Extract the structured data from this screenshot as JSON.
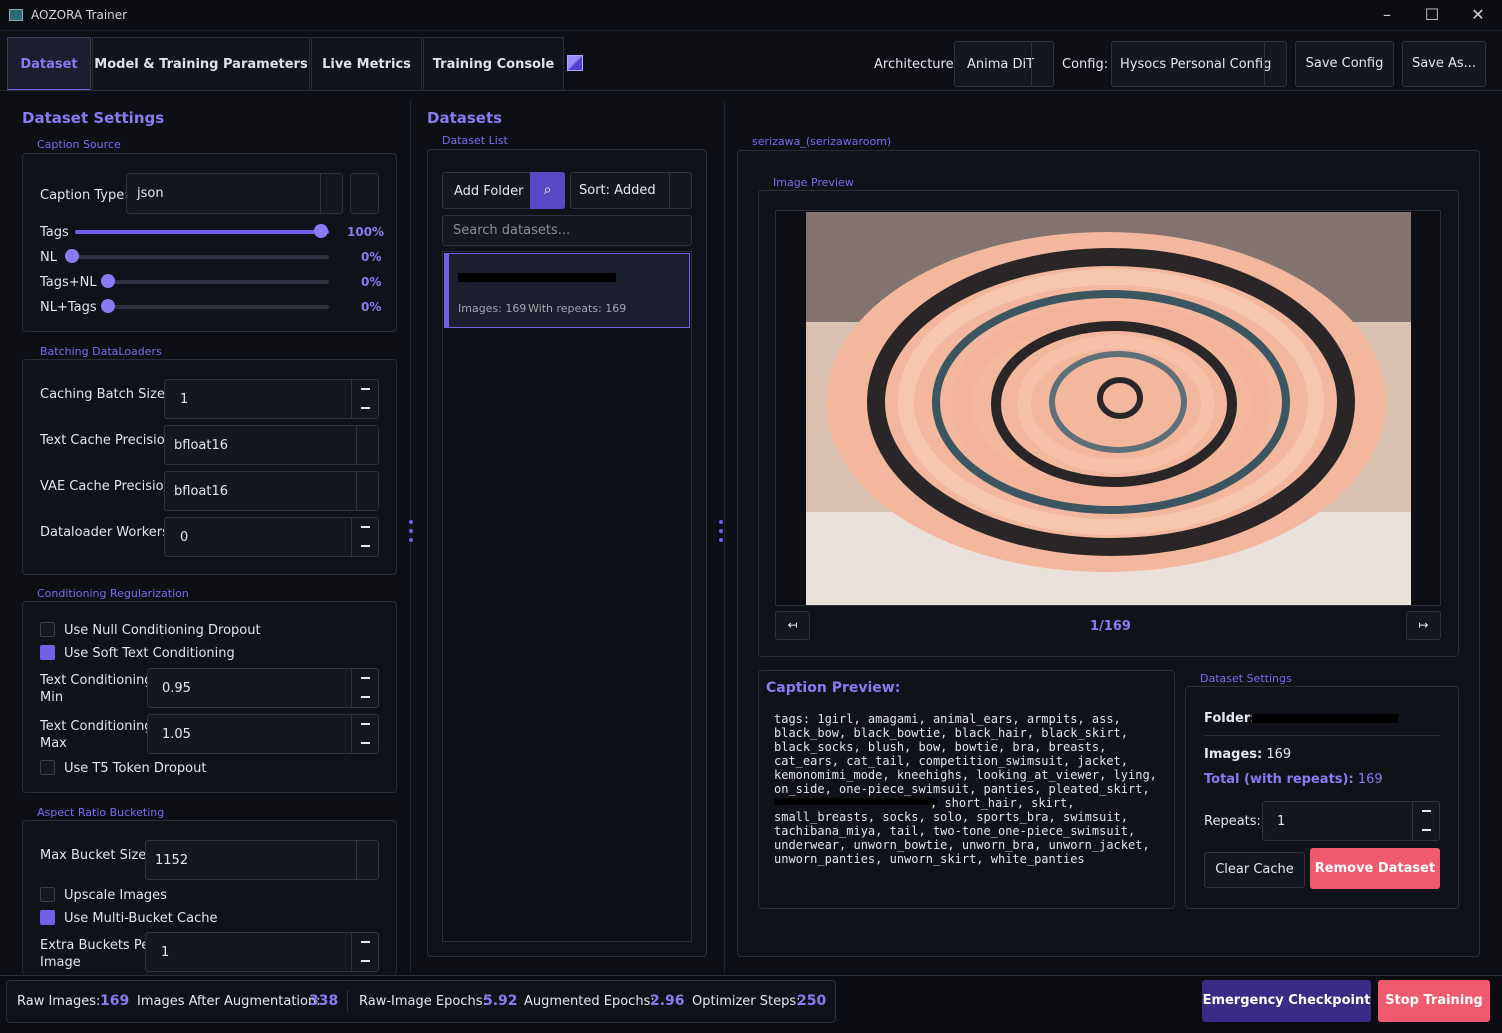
{
  "window": {
    "title": "AOZORA Trainer"
  },
  "tabs": [
    {
      "label": "Dataset"
    },
    {
      "label": "Model & Training Parameters"
    },
    {
      "label": "Live Metrics"
    },
    {
      "label": "Training Console"
    }
  ],
  "header": {
    "architecture_label": "Architecture:",
    "architecture_value": "Anima DiT",
    "config_label": "Config:",
    "config_value": "Hysocs Personal Config",
    "save_config": "Save Config",
    "save_as": "Save As..."
  },
  "left": {
    "title": "Dataset Settings",
    "caption_source": {
      "group": "Caption Source",
      "caption_type_label": "Caption Type:",
      "caption_type_value": "json",
      "sliders": [
        {
          "label": "Tags",
          "value": "100%",
          "fraction": 1.0
        },
        {
          "label": "NL",
          "value": "0%",
          "fraction": 0
        },
        {
          "label": "Tags+NL",
          "value": "0%",
          "fraction": 0
        },
        {
          "label": "NL+Tags",
          "value": "0%",
          "fraction": 0
        }
      ]
    },
    "batching": {
      "group": "Batching  DataLoaders",
      "caching_batch_size_label": "Caching Batch Size",
      "caching_batch_size_value": "1",
      "text_cache_precision_label": "Text Cache Precision",
      "text_cache_precision_value": "bfloat16",
      "vae_cache_precision_label": "VAE Cache Precision",
      "vae_cache_precision_value": "bfloat16",
      "workers_label": "Dataloader Workers",
      "workers_value": "0"
    },
    "conditioning": {
      "group": "Conditioning Regularization",
      "null_dropout": "Use Null Conditioning Dropout",
      "soft_text": "Use Soft Text Conditioning",
      "min_label_1": "Text Conditioning",
      "min_label_2": "Min",
      "min_value": "0.95",
      "max_label_1": "Text Conditioning",
      "max_label_2": "Max",
      "max_value": "1.05",
      "t5_dropout": "Use T5 Token Dropout"
    },
    "bucketing": {
      "group": "Aspect Ratio Bucketing",
      "max_bucket_label": "Max Bucket Size",
      "max_bucket_value": "1152",
      "upscale": "Upscale Images",
      "multi_bucket": "Use Multi-Bucket Cache",
      "extra_label_1": "Extra Buckets Per",
      "extra_label_2": "Image",
      "extra_value": "1"
    }
  },
  "middle": {
    "title": "Datasets",
    "group": "Dataset List",
    "add_folder": "Add Folder",
    "sort": "Sort: Added",
    "search_placeholder": "Search datasets...",
    "item": {
      "images": "Images: 169",
      "repeats": "With repeats: 169"
    }
  },
  "right": {
    "group": "serizawa_(serizawaroom)",
    "preview_group": "Image Preview",
    "counter": "1/169",
    "caption_title": "Caption Preview:",
    "caption_text_a": "tags: 1girl, amagami, animal_ears, armpits, ass,\nblack_bow, black_bowtie, black_hair, black_skirt,\nblack_socks, blush, bow, bowtie, bra, breasts,\ncat_ears, cat_tail, competition_swimsuit, jacket,\nkemonomimi_mode, kneehighs, looking_at_viewer, lying,\non_side, one-piece_swimsuit, panties, pleated_skirt,",
    "caption_text_b": ", short_hair, skirt,",
    "caption_text_c": "small_breasts, socks, solo, sports_bra, swimsuit,\ntachibana_miya, tail, two-tone_one-piece_swimsuit,\nunderwear, unworn_bowtie, unworn_bra, unworn_jacket,\nunworn_panties, unworn_skirt, white_panties",
    "settings_group": "Dataset Settings",
    "folder_label": "Folder:",
    "images_label": "Images:",
    "images_value": "169",
    "total_label": "Total (with repeats):",
    "total_value": "169",
    "repeats_label": "Repeats:",
    "repeats_value": "1",
    "clear_cache": "Clear Cache",
    "remove": "Remove Dataset"
  },
  "status": {
    "raw_label": "Raw Images:",
    "raw_value": "169",
    "aug_label": "Images After Augmentation:",
    "aug_value": "338",
    "raw_epochs_label": "Raw-Image Epochs:",
    "raw_epochs_value": "5.92",
    "aug_epochs_label": "Augmented Epochs:",
    "aug_epochs_value": "2.96",
    "steps_label": "Optimizer Steps:",
    "steps_value": "250",
    "emergency": "Emergency Checkpoint",
    "stop": "Stop Training"
  },
  "colors": {
    "accent": "#7360e8",
    "danger": "#f05a6e",
    "emergency": "#3b2a86"
  }
}
